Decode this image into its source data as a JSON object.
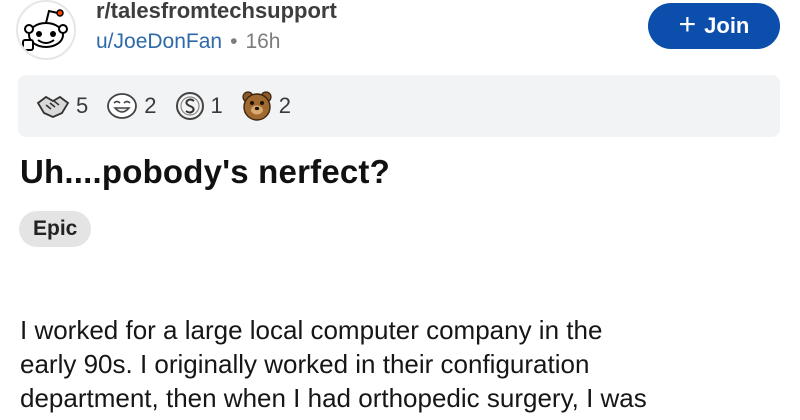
{
  "header": {
    "subreddit": "r/talesfromtechsupport",
    "user": "u/JoeDonFan",
    "separator": "•",
    "time": "16h",
    "join_label": "Join",
    "join_plus": "+"
  },
  "awards": [
    {
      "icon": "handshake-award-icon",
      "count": "5"
    },
    {
      "icon": "laughing-face-award-icon",
      "count": "2"
    },
    {
      "icon": "silver-coin-award-icon",
      "count": "1"
    },
    {
      "icon": "bear-award-icon",
      "count": "2"
    }
  ],
  "post": {
    "title": "Uh....pobody's nerfect?",
    "flair": "Epic",
    "body_lines": [
      "I worked for a large local computer company in the",
      "early 90s. I originally worked in their configuration",
      "department, then when I had orthopedic surgery, I was"
    ]
  },
  "colors": {
    "join_bg": "#0b4eab",
    "username": "#2e6aa8",
    "awards_bg": "#f2f3f4",
    "flair_bg": "#e4e4e4"
  }
}
